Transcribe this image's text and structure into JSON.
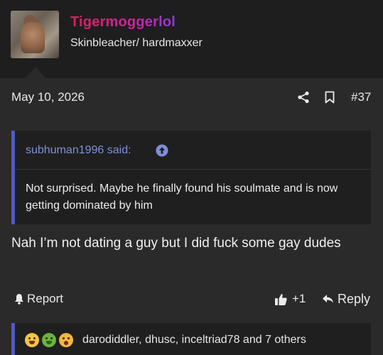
{
  "author": {
    "username": "Tigermoggerlol",
    "title": "Skinbleacher/ hardmaxxer"
  },
  "post": {
    "date": "May 10, 2026",
    "number": "#37",
    "message": "Nah I’m not dating a guy but I did fuck some gay dudes"
  },
  "quote": {
    "author_label": "subhuman1996 said:",
    "text": "Not surprised. Maybe he finally found his soulmate and is now getting dominated by him"
  },
  "actions": {
    "report_label": "Report",
    "like_count": "+1",
    "reply_label": "Reply"
  },
  "reactions": {
    "emojis": [
      "laughing-emoji",
      "sick-emoji",
      "shocked-emoji"
    ],
    "users_text": "darodiddler, dhusc, inceltriad78 and 7 others"
  },
  "colors": {
    "username_gradient": [
      "#e01e5a",
      "#8b3bd6"
    ],
    "quote_accent": "#4f5cbf",
    "quote_author": "#7f8fd6"
  }
}
